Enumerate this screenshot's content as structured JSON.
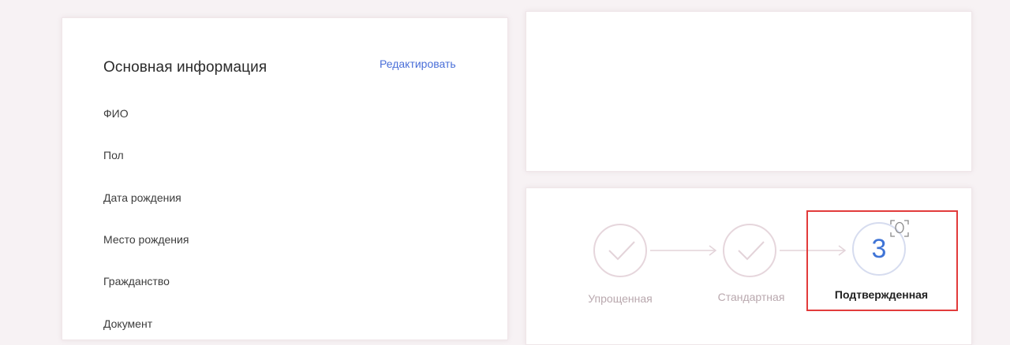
{
  "basic_info": {
    "title": "Основная информация",
    "edit_label": "Редактировать",
    "fields": [
      "ФИО",
      "Пол",
      "Дата рождения",
      "Место рождения",
      "Гражданство",
      "Документ"
    ]
  },
  "account_level": {
    "steps": [
      {
        "label": "Упрощенная",
        "state": "done"
      },
      {
        "label": "Стандартная",
        "state": "done"
      },
      {
        "label": "Подтвержденная",
        "number": "3",
        "state": "current"
      }
    ],
    "accent_color": "#3f74d6",
    "highlight_color": "#e23b3b"
  }
}
